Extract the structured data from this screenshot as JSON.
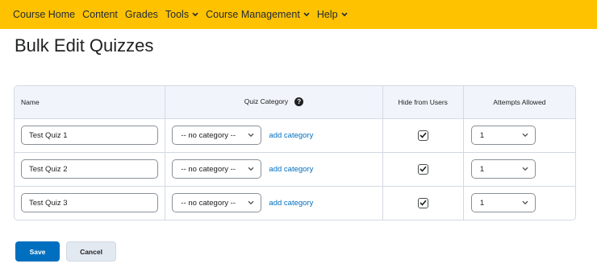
{
  "nav": {
    "items": [
      {
        "label": "Course Home",
        "has_menu": false
      },
      {
        "label": "Content",
        "has_menu": false
      },
      {
        "label": "Grades",
        "has_menu": false
      },
      {
        "label": "Tools",
        "has_menu": true
      },
      {
        "label": "Course Management",
        "has_menu": true
      },
      {
        "label": "Help",
        "has_menu": true
      }
    ],
    "bg_color": "#ffc200"
  },
  "page": {
    "title": "Bulk Edit Quizzes"
  },
  "table": {
    "headers": {
      "name": "Name",
      "category": "Quiz Category",
      "hide": "Hide from Users",
      "attempts": "Attempts Allowed"
    },
    "help_icon": "?",
    "rows": [
      {
        "name": "Test Quiz 1",
        "category": "-- no category --",
        "add_category": "add category",
        "hidden": true,
        "attempts": "1"
      },
      {
        "name": "Test Quiz 2",
        "category": "-- no category --",
        "add_category": "add category",
        "hidden": true,
        "attempts": "1"
      },
      {
        "name": "Test Quiz 3",
        "category": "-- no category --",
        "add_category": "add category",
        "hidden": true,
        "attempts": "1"
      }
    ]
  },
  "actions": {
    "save": "Save",
    "cancel": "Cancel"
  },
  "colors": {
    "primary": "#006fbf",
    "link": "#006fbf",
    "header_bg": "#f1f5fb"
  }
}
